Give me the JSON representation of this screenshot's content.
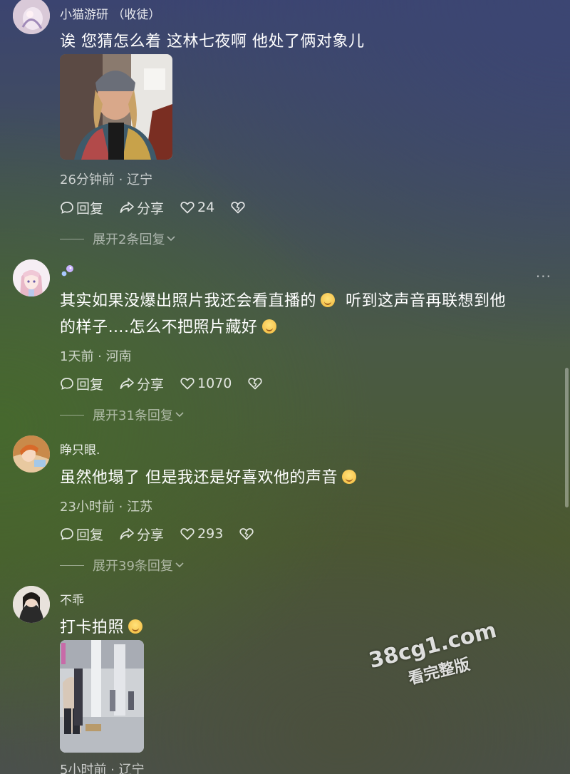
{
  "comments": [
    {
      "username": "小猫游研 （收徒）",
      "text": "诶 您猜怎么着 这林七夜啊 他处了俩对象儿",
      "meta": "26分钟前 · 辽宁",
      "reply_label": "回复",
      "share_label": "分享",
      "likes": "24",
      "expand_label": "展开2条回复"
    },
    {
      "username": "",
      "text_line1": "其实如果没爆出照片我还会看直播的",
      "text_line1b": "听到这声音再联想到他",
      "text_line2": "的样子….怎么不把照片藏好",
      "meta": "1天前 · 河南",
      "reply_label": "回复",
      "share_label": "分享",
      "likes": "1070",
      "expand_label": "展开31条回复",
      "more_label": "···"
    },
    {
      "username": "睁只眼.",
      "text": "虽然他塌了 但是我还是好喜欢他的声音",
      "meta": "23小时前 · 江苏",
      "reply_label": "回复",
      "share_label": "分享",
      "likes": "293",
      "expand_label": "展开39条回复"
    },
    {
      "username": "不乖",
      "text": "打卡拍照",
      "meta": "5小时前 · 辽宁"
    }
  ],
  "watermark": {
    "line1": "38cg1.com",
    "line2": "看完整版"
  },
  "icons": {
    "reply": "comment-bubble-icon",
    "share": "share-arrow-icon",
    "like": "heart-icon",
    "dislike": "broken-heart-icon",
    "expand": "chevron-down-icon"
  }
}
